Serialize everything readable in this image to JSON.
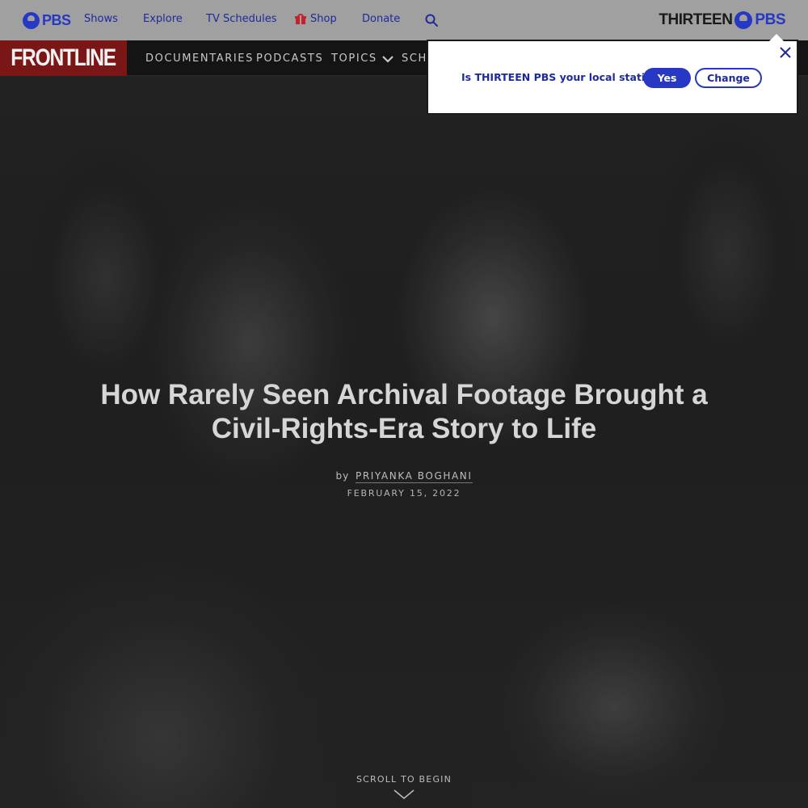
{
  "pbs_bar": {
    "logo_text": "PBS",
    "nav": {
      "shows": "Shows",
      "explore": "Explore",
      "tv_schedules": "TV Schedules",
      "shop": "Shop",
      "donate": "Donate"
    },
    "search_icon": "search-icon",
    "station": {
      "name": "THIRTEEN",
      "network": "PBS"
    }
  },
  "frontline_bar": {
    "logo_text": "FRONTLINE",
    "nav": {
      "documentaries": "DOCUMENTARIES",
      "podcasts": "PODCASTS",
      "topics": "TOPICS",
      "schedule_partial": "SCH"
    }
  },
  "station_popup": {
    "question": "Is THIRTEEN PBS your local station?",
    "yes_label": "Yes",
    "change_label": "Change",
    "close_icon": "close-icon"
  },
  "article": {
    "title": "How Rarely Seen Archival Footage Brought a Civil-Rights-Era Story to Life",
    "by_label": "by",
    "author": "PRIYANKA BOGHANI",
    "date": "FEBRUARY 15, 2022"
  },
  "scroll_prompt": {
    "label": "SCROLL TO BEGIN"
  },
  "colors": {
    "pbs_blue": "#2638c4",
    "frontline_red": "#7b1616",
    "shop_icon_red": "#c2232d"
  }
}
